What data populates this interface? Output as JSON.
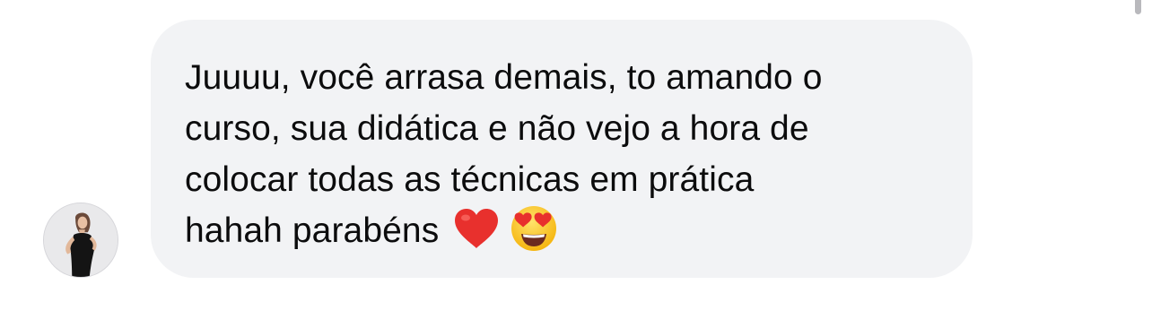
{
  "conversation": {
    "message": {
      "lines": [
        "Juuuu, você arrasa demais, to amando o",
        "curso, sua didática e não vejo a hora de",
        "colocar todas as técnicas em prática",
        "hahah parabéns"
      ],
      "emojis": [
        "red-heart-icon",
        "heart-eyes-face-icon"
      ]
    },
    "sender": {
      "avatar_icon": "user-avatar-photo"
    }
  },
  "colors": {
    "bubble_background": "#f2f3f5",
    "text": "#0c0c0d",
    "heart": "#e8302d",
    "face": "#fcc21b"
  }
}
